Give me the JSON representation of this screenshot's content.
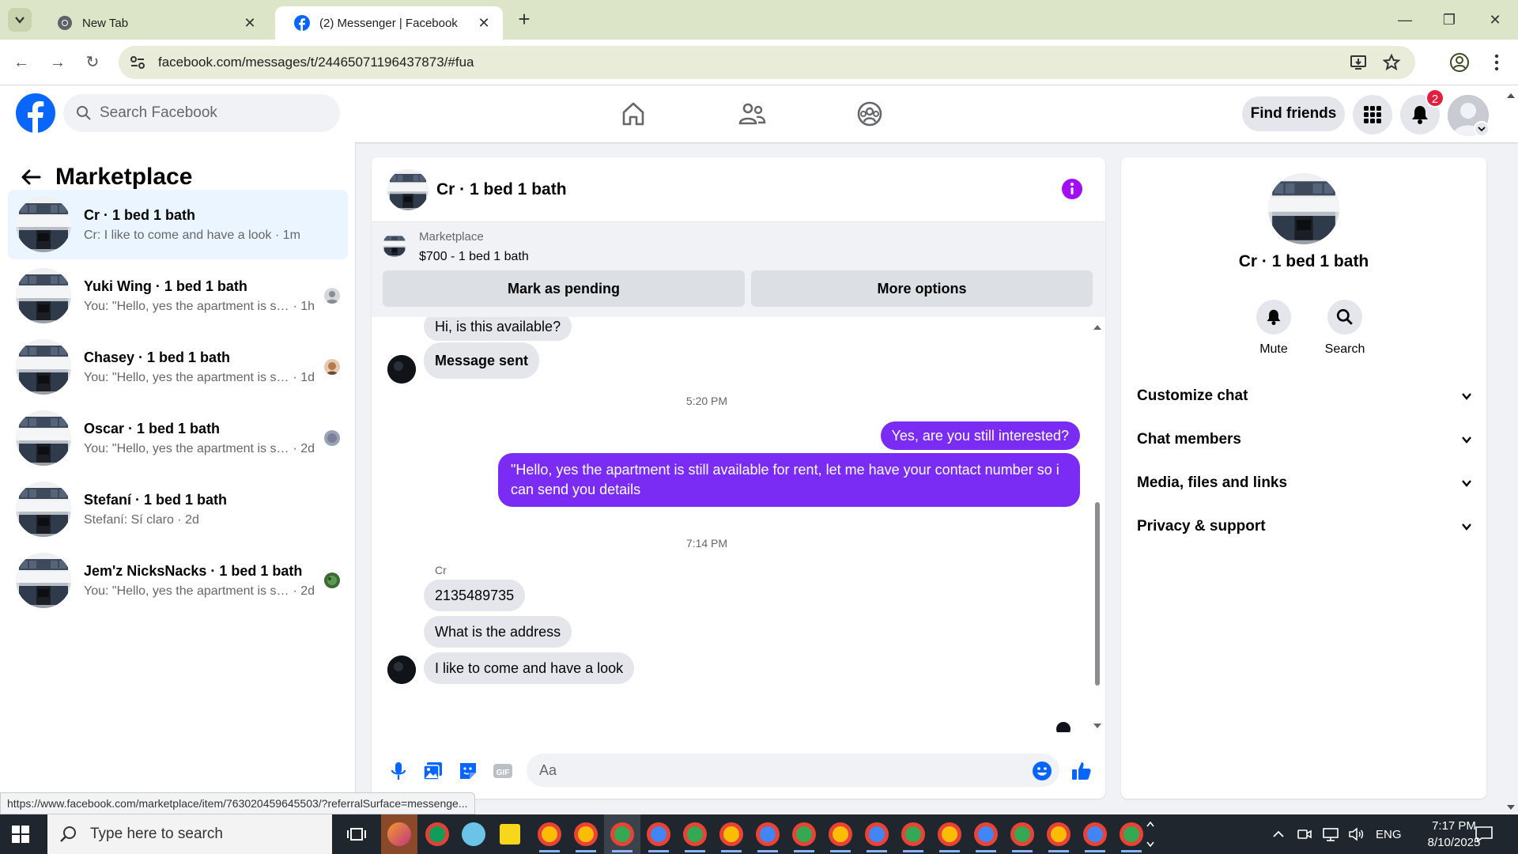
{
  "browser": {
    "tabs": [
      {
        "title": "New Tab",
        "active": false
      },
      {
        "title": "(2) Messenger | Facebook",
        "active": true
      }
    ],
    "url": "facebook.com/messages/t/24465071196437873/#fua"
  },
  "fb_nav": {
    "search_placeholder": "Search Facebook",
    "find_friends_label": "Find friends",
    "notification_count": "2"
  },
  "sidebar": {
    "title": "Marketplace",
    "conversations": [
      {
        "name": "Cr · 1 bed 1 bath",
        "preview": "Cr: I like to come and have a look",
        "time": "1m",
        "selected": true
      },
      {
        "name": "Yuki Wing · 1 bed 1 bath",
        "preview": "You: \"Hello, yes the apartment is sti...",
        "time": "1h"
      },
      {
        "name": "Chasey · 1 bed 1 bath",
        "preview": "You: \"Hello, yes the apartment is sti...",
        "time": "1d"
      },
      {
        "name": "Oscar · 1 bed 1 bath",
        "preview": "You: \"Hello, yes the apartment is sti...",
        "time": "2d"
      },
      {
        "name": "Stefaní · 1 bed 1 bath",
        "preview": "Stefaní: Sí claro",
        "time": "2d"
      },
      {
        "name": "Jem'z NicksNacks · 1 bed 1 bath",
        "preview": "You: \"Hello, yes the apartment is sti...",
        "time": "2d"
      }
    ]
  },
  "chat": {
    "title": "Cr · 1 bed 1 bath",
    "listing_source": "Marketplace",
    "listing_price": "$700 - 1 bed 1 bath",
    "mark_pending_label": "Mark as pending",
    "more_options_label": "More options",
    "messages": {
      "m1": "Hi, is this available?",
      "m2": "Message sent",
      "t1": "5:20 PM",
      "m3": "Yes, are you still interested?",
      "m4": "\"Hello, yes the apartment is still available for rent, let me have your contact number so i can send you details",
      "t2": "7:14 PM",
      "sender": "Cr",
      "m5": "2135489735",
      "m6": "What is the address",
      "m7": "I like to come and have a look"
    },
    "composer_placeholder": "Aa"
  },
  "info_panel": {
    "name": "Cr · 1 bed 1 bath",
    "mute_label": "Mute",
    "search_label": "Search",
    "sections": [
      "Customize chat",
      "Chat members",
      "Media, files and links",
      "Privacy & support"
    ]
  },
  "status_url": "https://www.facebook.com/marketplace/item/763020459645503/?referralSurface=messenge...",
  "taskbar": {
    "search_placeholder": "Type here to search",
    "language": "ENG",
    "time": "7:17 PM",
    "date": "8/10/2025"
  },
  "colors": {
    "fb_blue": "#0866ff",
    "outgoing_bubble": "#7a2cf4",
    "info_icon": "#a10ef2"
  }
}
